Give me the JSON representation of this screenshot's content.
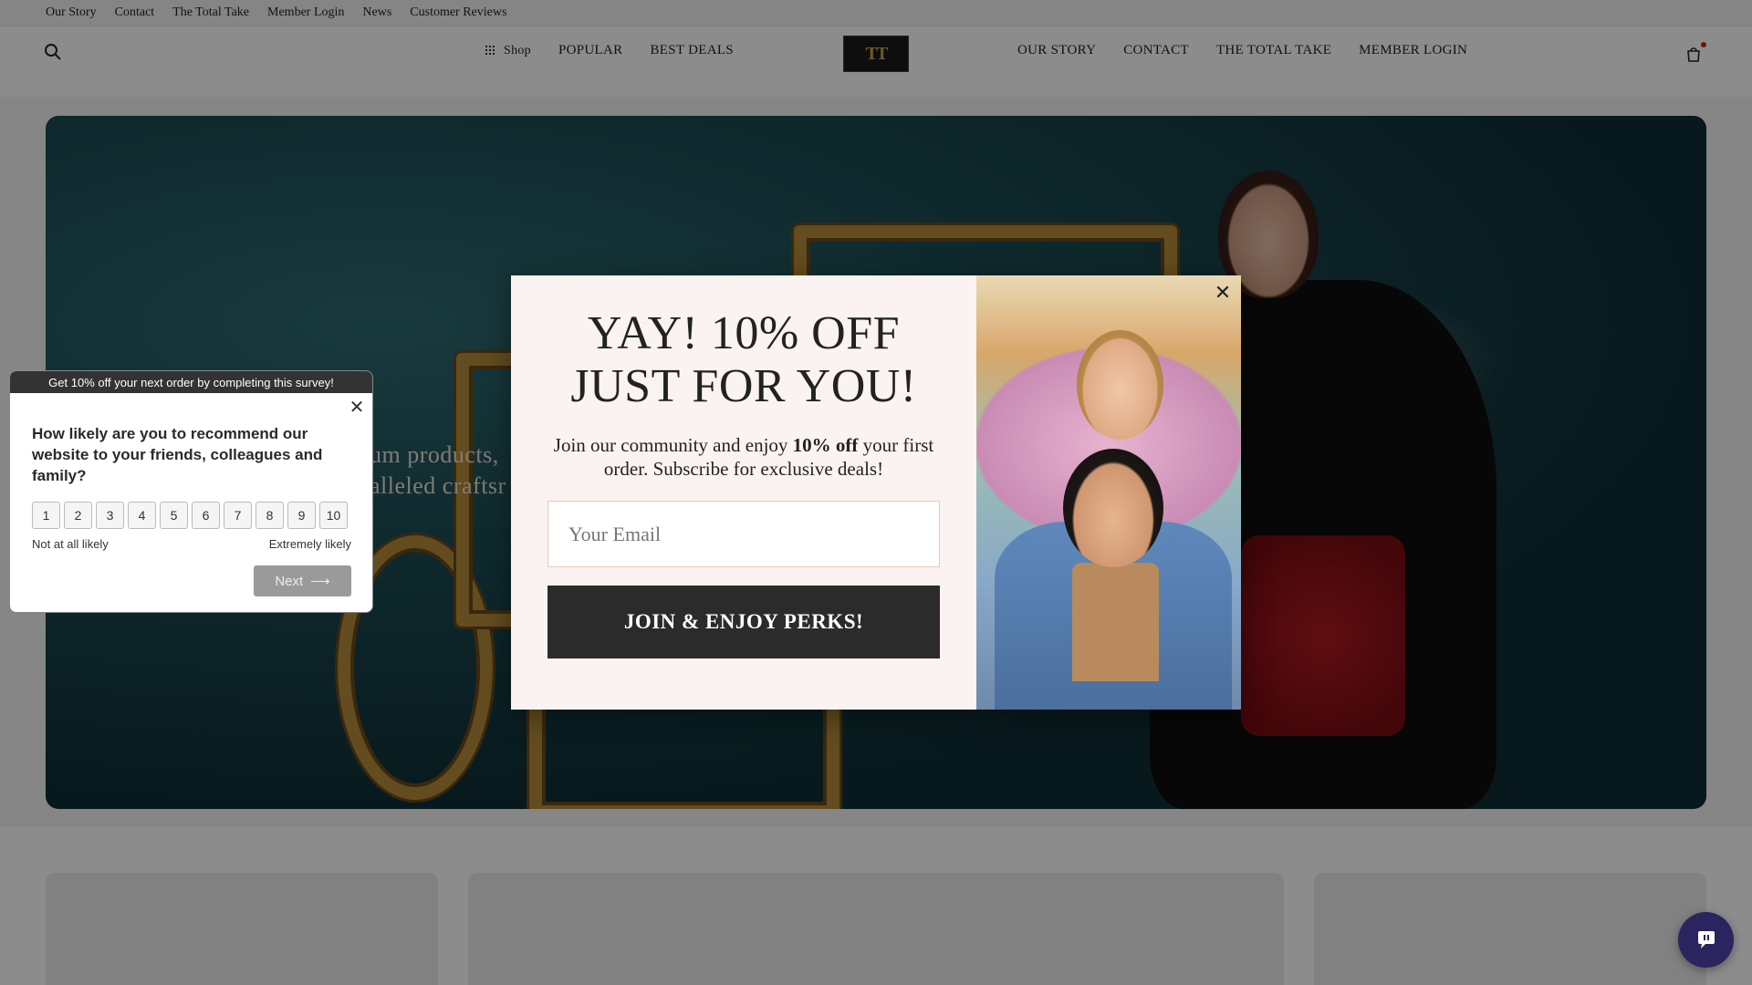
{
  "utility_nav": [
    "Our Story",
    "Contact",
    "The Total Take",
    "Member Login",
    "News",
    "Customer Reviews"
  ],
  "header": {
    "shop_label": "Shop",
    "nav_left": [
      "POPULAR",
      "BEST DEALS"
    ],
    "nav_right": [
      "OUR STORY",
      "CONTACT",
      "THE TOTAL TAKE",
      "MEMBER LOGIN"
    ],
    "logo_text": "TT",
    "icons": {
      "search": "search-icon",
      "cart": "cart-icon",
      "shop_grid": "grid-icon"
    }
  },
  "hero": {
    "text_line1": "um products,",
    "text_line2": "alleled craftsr"
  },
  "survey": {
    "banner": "Get 10% off your next order by completing this survey!",
    "question": "How likely are you to recommend our website to your friends, colleagues and family?",
    "scale": [
      "1",
      "2",
      "3",
      "4",
      "5",
      "6",
      "7",
      "8",
      "9",
      "10"
    ],
    "label_low": "Not at all likely",
    "label_high": "Extremely likely",
    "next_label": "Next",
    "close_glyph": "✕",
    "next_arrow": "⟶"
  },
  "promo": {
    "title_line1": "YAY! 10% OFF",
    "title_line2": "JUST FOR YOU!",
    "subtitle_pre": "Join our community and enjoy ",
    "subtitle_bold": "10% off",
    "subtitle_post": " your first order. Subscribe for exclusive deals!",
    "email_placeholder": "Your Email",
    "button_label": "JOIN & ENJOY PERKS!",
    "close_glyph": "✕"
  },
  "chat": {
    "icon": "chat-icon"
  },
  "colors": {
    "accent_dark": "#2b2b2b",
    "modal_bg": "#faf3f1",
    "chat_bg": "#2a245f",
    "cart_badge": "#d0201b"
  }
}
